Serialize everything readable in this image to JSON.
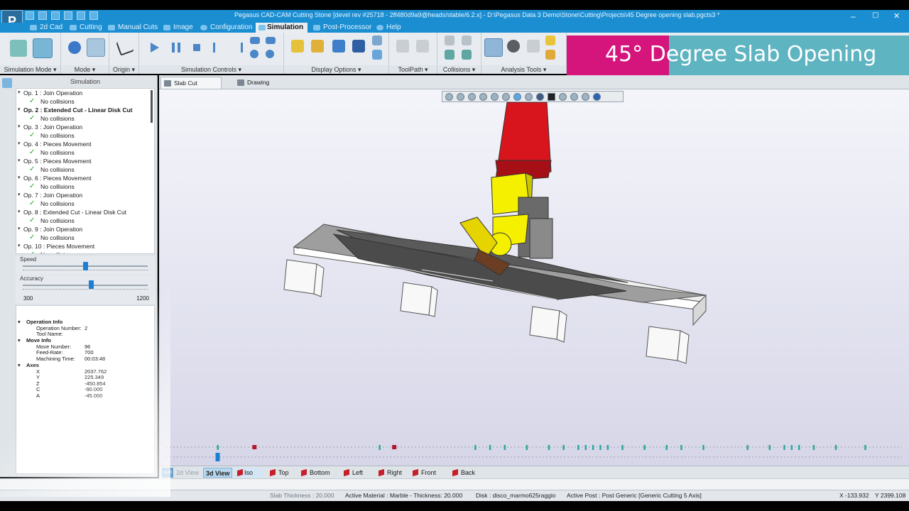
{
  "window": {
    "title": "Pegasus CAD-CAM Cutting Stone [devel rev #25718 - 2ff480d9a9@heads/stable/6.2.x] - D:\\Pegasus Data 3 Demo\\Stone\\Cutting\\Projects\\45 Degree opening slab.pgcts3 *",
    "app_logo": "P",
    "min": "–",
    "max": "▢",
    "close": "✕"
  },
  "tabs": [
    {
      "label": "2d Cad",
      "icon": "cad-icon"
    },
    {
      "label": "Cutting",
      "icon": "cutting-icon"
    },
    {
      "label": "Manual Cuts",
      "icon": "manual-cuts-icon"
    },
    {
      "label": "Image",
      "icon": "image-icon"
    },
    {
      "label": "Configuration",
      "icon": "gear-icon"
    },
    {
      "label": "Simulation",
      "icon": "simulation-icon",
      "active": true
    },
    {
      "label": "Post-Processor",
      "icon": "post-processor-icon"
    },
    {
      "label": "Help",
      "icon": "help-icon"
    }
  ],
  "ribbon_groups": [
    {
      "label": "Simulation Mode ▾"
    },
    {
      "label": "Mode ▾"
    },
    {
      "label": "Origin ▾"
    },
    {
      "label": "Simulation Controls ▾"
    },
    {
      "label": "Display Options ▾"
    },
    {
      "label": "ToolPath ▾"
    },
    {
      "label": "Collisions ▾"
    },
    {
      "label": "Analysis Tools ▾"
    }
  ],
  "banner": {
    "text": "45° Degree Slab Opening"
  },
  "simulation_header": "Simulation",
  "operations": [
    {
      "label": "Op. 1 : Join Operation",
      "status": "No collisions"
    },
    {
      "label": "Op. 2 : Extended Cut - Linear Disk Cut",
      "status": "No collisions",
      "bold": true
    },
    {
      "label": "Op. 3 : Join Operation",
      "status": "No collisions"
    },
    {
      "label": "Op. 4 : Pieces Movement",
      "status": "No collisions"
    },
    {
      "label": "Op. 5 : Pieces Movement",
      "status": "No collisions"
    },
    {
      "label": "Op. 6 : Pieces Movement",
      "status": "No collisions"
    },
    {
      "label": "Op. 7 : Join Operation",
      "status": "No collisions"
    },
    {
      "label": "Op. 8 : Extended Cut - Linear Disk Cut",
      "status": "No collisions"
    },
    {
      "label": "Op. 9 : Join Operation",
      "status": "No collisions"
    },
    {
      "label": "Op. 10 : Pieces Movement",
      "status": "No collisions"
    }
  ],
  "speed": {
    "label": "Speed",
    "value": 0.5
  },
  "accuracy": {
    "label": "Accuracy",
    "min": "300",
    "max": "1200",
    "value": 0.55
  },
  "info": {
    "operation_info": "Operation Info",
    "operation_number_label": "Operation Number:",
    "operation_number": "2",
    "tool_name_label": "Tool Name:",
    "tool_name": "",
    "move_info": "Move Info",
    "move_number_label": "Move Number:",
    "move_number": "96",
    "feed_rate_label": "Feed-Rate:",
    "feed_rate": "700",
    "machining_time_label": "Machining Time:",
    "machining_time": "00:03:48",
    "axes": "Axes",
    "x_label": "X",
    "x": "2037.762",
    "y_label": "Y",
    "y": "225.349",
    "z_label": "Z",
    "z": "-450.854",
    "c_label": "C",
    "c": "-90.000",
    "a_label": "A",
    "a": "-45.000"
  },
  "view_tabs": [
    {
      "label": "Slab Cut",
      "active": true
    },
    {
      "label": "Drawing"
    }
  ],
  "timeline": {
    "markers_teal": [
      0.07,
      0.29,
      0.42,
      0.44,
      0.46,
      0.49,
      0.52,
      0.54,
      0.56,
      0.57,
      0.58,
      0.59,
      0.6,
      0.62,
      0.65,
      0.68,
      0.7,
      0.73,
      0.79,
      0.82,
      0.84,
      0.85,
      0.86,
      0.88,
      0.91,
      0.95
    ],
    "markers_red": [
      0.12,
      0.31
    ],
    "position": 0.07
  },
  "view_buttons": {
    "auto": "auto",
    "view2d": "2d View",
    "view3d": "3d View",
    "iso": "Iso",
    "top": "Top",
    "bottom": "Bottom",
    "left": "Left",
    "right": "Right",
    "front": "Front",
    "back": "Back"
  },
  "status": {
    "slab_thickness": "Slab Thickness : 20.000",
    "active_material": "Active Material : Marble - Thickness: 20.000",
    "disk": "Disk : disco_marmo625raggio",
    "active_post": "Active Post : Post Generic [Generic Cutting 5 Axis]",
    "coords_x": "X -133.932",
    "coords_y": "Y 2399.108"
  },
  "colors": {
    "accent": "#1b8ed1",
    "robot_red": "#d8141c",
    "robot_yellow": "#f4f000",
    "banner_pink": "#d5147c",
    "banner_teal": "#5fb4c2"
  }
}
